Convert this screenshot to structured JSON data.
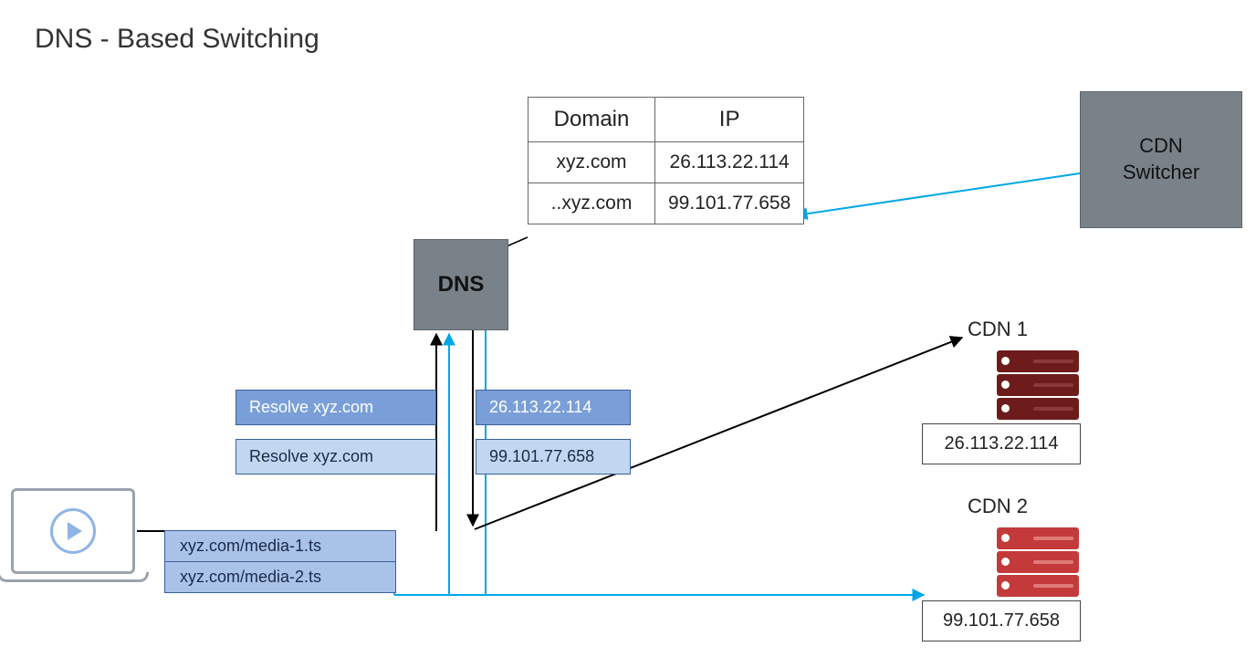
{
  "title": "DNS - Based Switching",
  "dns": {
    "label": "DNS"
  },
  "switcher": {
    "label": "CDN\nSwitcher"
  },
  "table": {
    "headers": {
      "domain": "Domain",
      "ip": "IP"
    },
    "rows": [
      {
        "domain": "xyz.com",
        "ip": "26.113.22.114"
      },
      {
        "domain": "..xyz.com",
        "ip": "99.101.77.658"
      }
    ]
  },
  "resolve": {
    "req1": "Resolve xyz.com",
    "req2": "Resolve xyz.com",
    "ip1": "26.113.22.114",
    "ip2": "99.101.77.658"
  },
  "media": {
    "url1": "xyz.com/media-1.ts",
    "url2": "xyz.com/media-2.ts"
  },
  "cdn1": {
    "label": "CDN 1",
    "ip": "26.113.22.114"
  },
  "cdn2": {
    "label": "CDN 2",
    "ip": "99.101.77.658"
  },
  "colors": {
    "accent_blue": "#00a7e6",
    "node_grey": "#7a8289",
    "box_blue_dark": "#7a9fd8",
    "box_blue_light": "#c3d6f0",
    "server_dark": "#6d1b1b",
    "server_red": "#c43a3a"
  }
}
